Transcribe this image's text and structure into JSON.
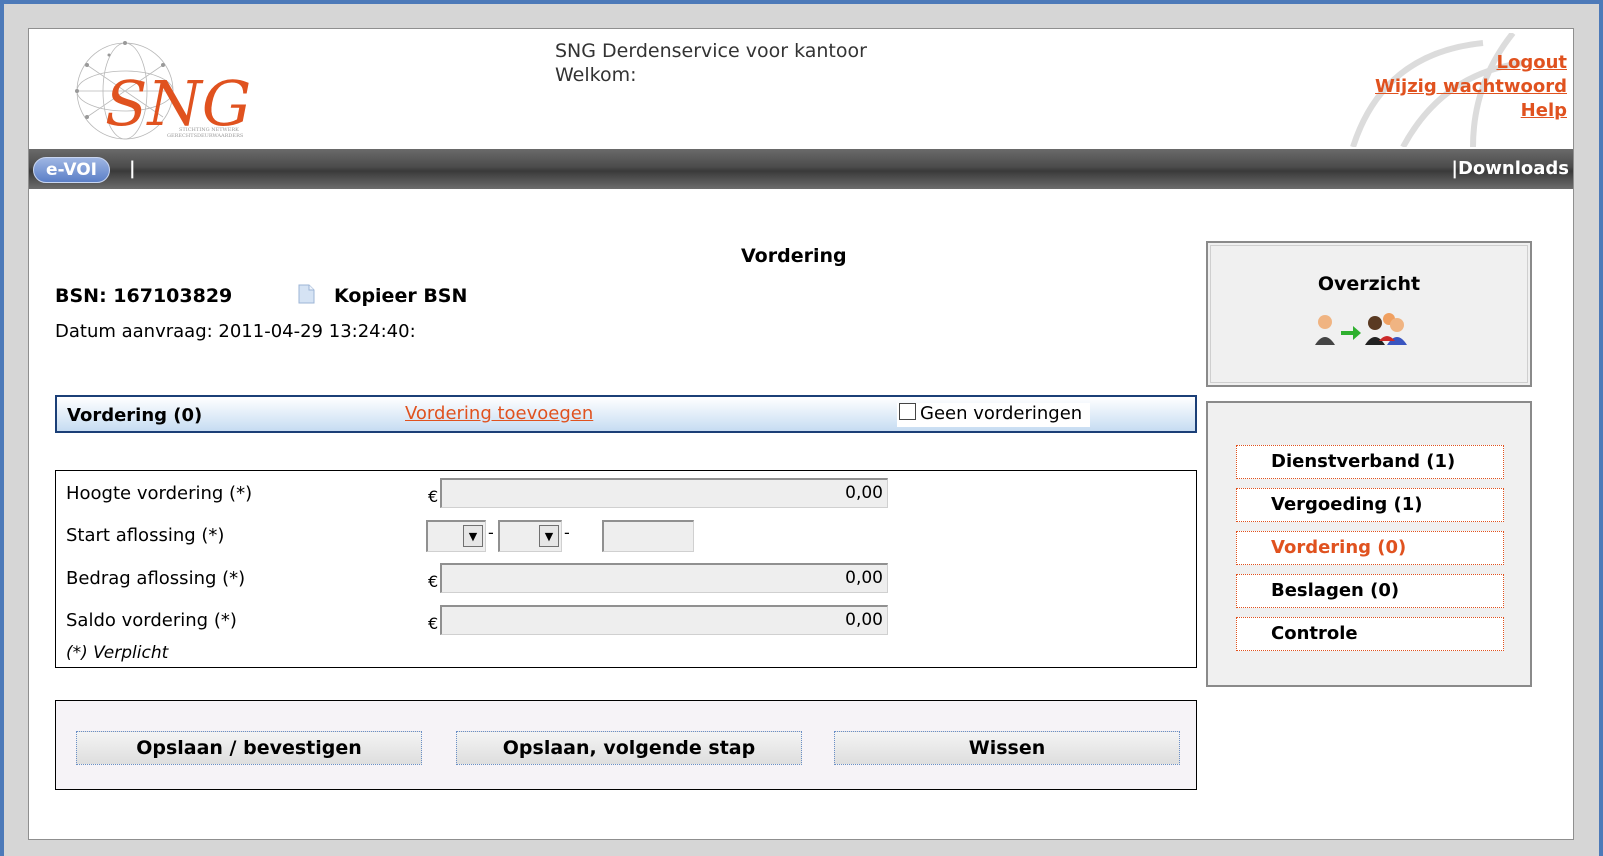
{
  "header": {
    "app_title": "SNG Derdenservice voor kantoor",
    "welcome": "Welkom:",
    "links": [
      "Logout",
      "Wijzig wachtwoord",
      "Help"
    ]
  },
  "navbar": {
    "tab": "e-VOI",
    "separator": "|",
    "downloads": "|Downloads"
  },
  "main": {
    "title": "Vordering",
    "bsn": "BSN: 167103829",
    "copy_bsn": "Kopieer BSN",
    "datum": "Datum aanvraag: 2011-04-29 13:24:40:"
  },
  "vordering_bar": {
    "title": "Vordering (0)",
    "add_link": "Vordering toevoegen",
    "geen_label": "Geen vorderingen"
  },
  "form": {
    "hoogte_label": "Hoogte vordering (*)",
    "start_label": "Start aflossing (*)",
    "bedrag_label": "Bedrag aflossing (*)",
    "saldo_label": "Saldo vordering (*)",
    "currency": "€",
    "hoogte_value": "0,00",
    "bedrag_value": "0,00",
    "saldo_value": "0,00",
    "date_separator": "-",
    "verplicht": "(*) Verplicht"
  },
  "buttons": {
    "save_confirm": "Opslaan / bevestigen",
    "save_next": "Opslaan, volgende stap",
    "clear": "Wissen"
  },
  "sidebar": {
    "overzicht": "Overzicht",
    "steps": [
      {
        "label": "Dienstverband (1)"
      },
      {
        "label": "Vergoeding (1)"
      },
      {
        "label": "Vordering (0)",
        "active": true
      },
      {
        "label": "Beslagen (0)"
      },
      {
        "label": "Controle"
      }
    ]
  },
  "colors": {
    "accent": "#e0521f",
    "frame": "#4d7ab9",
    "bar_border": "#1b3f77"
  }
}
